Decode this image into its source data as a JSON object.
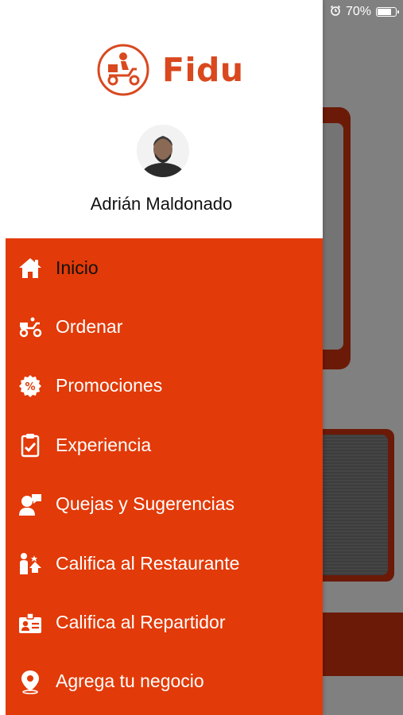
{
  "status_bar": {
    "battery_percent": "70%",
    "alarm_icon": "alarm-clock-icon"
  },
  "brand": {
    "name": "Fidu",
    "color": "#d9481f"
  },
  "user": {
    "name": "Adrián Maldonado"
  },
  "menu": {
    "accent": "#e23a08",
    "items": [
      {
        "label": "Inicio",
        "icon": "home-icon",
        "active": true
      },
      {
        "label": "Ordenar",
        "icon": "scooter-icon"
      },
      {
        "label": "Promociones",
        "icon": "percent-badge-icon"
      },
      {
        "label": "Experiencia",
        "icon": "clipboard-check-icon"
      },
      {
        "label": "Quejas y Sugerencias",
        "icon": "user-speech-icon"
      },
      {
        "label": "Califica al Restaurante",
        "icon": "user-rating-icon"
      },
      {
        "label": "Califica al Repartidor",
        "icon": "id-badge-icon"
      },
      {
        "label": "Agrega tu negocio",
        "icon": "map-pin-icon"
      }
    ]
  }
}
